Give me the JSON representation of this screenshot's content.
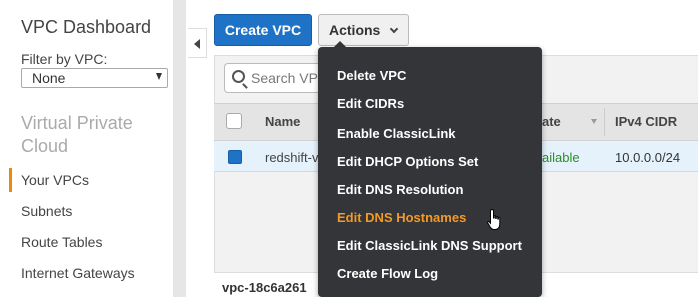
{
  "sidebar": {
    "title": "VPC Dashboard",
    "filter_label": "Filter by VPC:",
    "filter_value": "None",
    "section": "Virtual Private Cloud",
    "items": [
      "Your VPCs",
      "Subnets",
      "Route Tables",
      "Internet Gateways"
    ],
    "active_color": "#e88a0c"
  },
  "toolbar": {
    "create_label": "Create VPC",
    "actions_label": "Actions"
  },
  "search": {
    "placeholder": "Search VP"
  },
  "table": {
    "headers": [
      "Name",
      "ate",
      "IPv4 CIDR"
    ],
    "row": {
      "name": "redshift-v",
      "state": "ailable",
      "cidr": "10.0.0.0/24",
      "selected": true
    }
  },
  "detail": {
    "vpc_id": "vpc-18c6a261"
  },
  "actions_menu": {
    "items": [
      "Delete VPC",
      "Edit CIDRs",
      "Enable ClassicLink",
      "Edit DHCP Options Set",
      "Edit DNS Resolution",
      "Edit DNS Hostnames",
      "Edit ClassicLink DNS Support",
      "Create Flow Log"
    ],
    "hovered_index": 5,
    "hover_color": "#f29a27"
  },
  "colors": {
    "primary": "#1f73c7",
    "menu_bg": "#333538",
    "available": "#2e8b2e"
  }
}
